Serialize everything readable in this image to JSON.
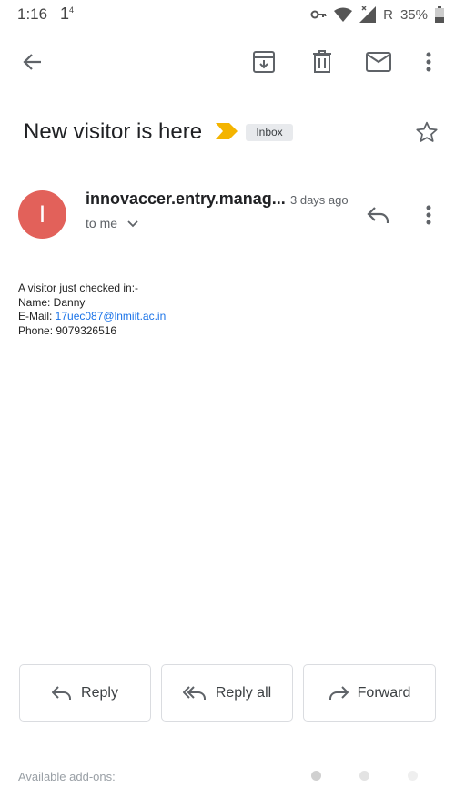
{
  "status_bar": {
    "time": "1:16",
    "notification_glyph": "1",
    "notification_superscript": "4",
    "roaming_label": "R",
    "battery": "35%"
  },
  "toolbar": {
    "back_icon": "arrow-left-icon",
    "archive_icon": "archive-icon",
    "delete_icon": "trash-icon",
    "mark_unread_icon": "envelope-icon",
    "more_icon": "more-vertical-icon"
  },
  "email": {
    "subject": "New visitor is here",
    "label": "Inbox",
    "sender_initial": "I",
    "sender": "innovaccer.entry.manag...",
    "date": "3 days ago",
    "recipient": "to me",
    "body": {
      "line1": "A visitor just checked in:-",
      "name_line": "Name: Danny",
      "email_prefix": "E-Mail: ",
      "email_link": "17uec087@lnmiit.ac.in",
      "phone_line": "Phone: 9079326516"
    }
  },
  "actions": {
    "reply": "Reply",
    "reply_all": "Reply all",
    "forward": "Forward"
  },
  "addons": {
    "label": "Available add-ons:"
  },
  "colors": {
    "avatar": "#e2615a",
    "importance_marker": "#f4b400",
    "link": "#1a73e8"
  }
}
